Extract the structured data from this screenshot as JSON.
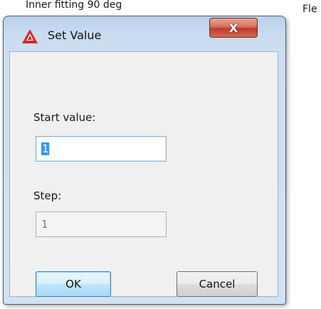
{
  "background": {
    "left_text": "Inner fitting 90 deg",
    "right_text": "Fle"
  },
  "dialog": {
    "title": "Set Value",
    "close_label": "X",
    "start_label": "Start value:",
    "start_value": "1",
    "step_label": "Step:",
    "step_value": "1",
    "ok_label": "OK",
    "cancel_label": "Cancel"
  },
  "colors": {
    "selection": "#3399ff",
    "close_button": "#c0392b",
    "app_icon": "#d42a1f"
  }
}
